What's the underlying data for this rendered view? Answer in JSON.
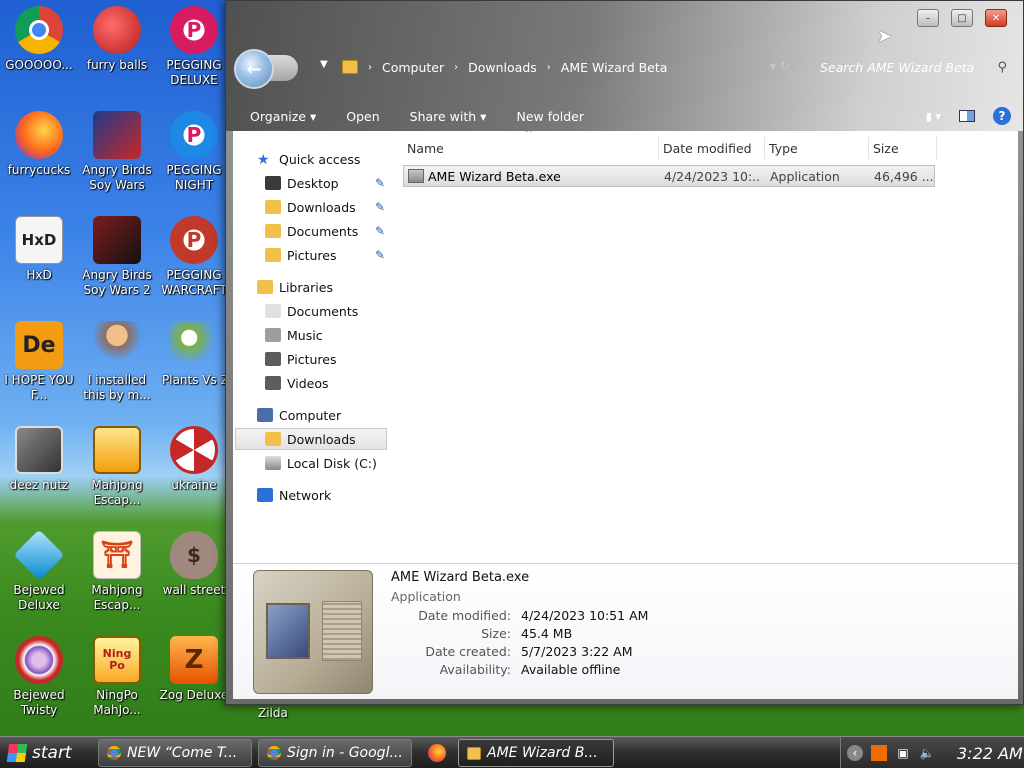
{
  "desktop": {
    "icons": [
      {
        "label": "GOOOOO...",
        "glyph": "",
        "color": "#4285f4"
      },
      {
        "label": "furry balls",
        "glyph": "",
        "color": "#e53935"
      },
      {
        "label": "PEGGING DELUXE",
        "glyph": "P",
        "color": "#d81b60"
      },
      {
        "label": "furrycucks",
        "glyph": "",
        "color": "#ff7043"
      },
      {
        "label": "Angry Birds Soy Wars",
        "glyph": "",
        "color": "#1e3a8a"
      },
      {
        "label": "PEGGING NIGHT",
        "glyph": "P",
        "color": "#1e88e5"
      },
      {
        "label": "HxD",
        "glyph": "HxD",
        "color": "#f5f5f5"
      },
      {
        "label": "Angry Birds Soy Wars 2",
        "glyph": "",
        "color": "#7f1d1d"
      },
      {
        "label": "PEGGING WARCRAFT",
        "glyph": "P",
        "color": "#c0392b"
      },
      {
        "label": "I HOPE YOU F...",
        "glyph": "De",
        "color": "#f39c12"
      },
      {
        "label": "I installed this by m...",
        "glyph": "",
        "color": "#8d6e63"
      },
      {
        "label": "Plants Vs Z",
        "glyph": "",
        "color": "#7cb342"
      },
      {
        "label": "deez nutz",
        "glyph": "",
        "color": "#555555"
      },
      {
        "label": "Mahjong Escap...",
        "glyph": "",
        "color": "#fbc02d"
      },
      {
        "label": "ukraine",
        "glyph": "",
        "color": "#c62828"
      },
      {
        "label": "Bejewed Deluxe",
        "glyph": "",
        "color": "#29b6f6"
      },
      {
        "label": "Mahjong Escap...",
        "glyph": "",
        "color": "#ef6c00"
      },
      {
        "label": "wall street",
        "glyph": "$",
        "color": "#8d6e63"
      },
      {
        "label": "Bejewed Twisty",
        "glyph": "",
        "color": "#7e57c2"
      },
      {
        "label": "NingPo MahJo...",
        "glyph": "Ning Po",
        "color": "#f9a825"
      },
      {
        "label": "Zog Deluxe",
        "glyph": "Z",
        "color": "#ef6c00"
      }
    ],
    "extra_label": "Zilda"
  },
  "window": {
    "breadcrumbs": [
      "Computer",
      "Downloads",
      "AME Wizard Beta"
    ],
    "search_placeholder": "Search AME Wizard Beta",
    "controls": {
      "minimize": "–",
      "maximize": "□",
      "close": "✕"
    },
    "toolbar": [
      "Organize ▾",
      "Open",
      "Share with ▾",
      "New folder"
    ],
    "nav": {
      "quick_access": "Quick access",
      "quick_items": [
        "Desktop",
        "Downloads",
        "Documents",
        "Pictures"
      ],
      "libraries": "Libraries",
      "library_items": [
        "Documents",
        "Music",
        "Pictures",
        "Videos"
      ],
      "computer": "Computer",
      "computer_items": [
        "Downloads",
        "Local Disk (C:)"
      ],
      "network": "Network"
    },
    "columns": [
      "Name",
      "Date modified",
      "Type",
      "Size"
    ],
    "files": [
      {
        "name": "AME Wizard Beta.exe",
        "date": "4/24/2023 10:...",
        "type": "Application",
        "size": "46,496 ..."
      }
    ],
    "details": {
      "name": "AME Wizard Beta.exe",
      "type": "Application",
      "fields": [
        {
          "key": "Date modified:",
          "value": "4/24/2023 10:51 AM"
        },
        {
          "key": "Size:",
          "value": "45.4 MB"
        },
        {
          "key": "Date created:",
          "value": "5/7/2023 3:22 AM"
        },
        {
          "key": "Availability:",
          "value": "Available offline"
        }
      ]
    }
  },
  "taskbar": {
    "start": "start",
    "tasks": [
      "NEW “Come T...",
      "Sign in - Googl...",
      "AME Wizard B..."
    ],
    "clock": "3:22 AM"
  },
  "colors": {
    "accent": "#2a72d8",
    "selection": "#e2e2e2"
  }
}
